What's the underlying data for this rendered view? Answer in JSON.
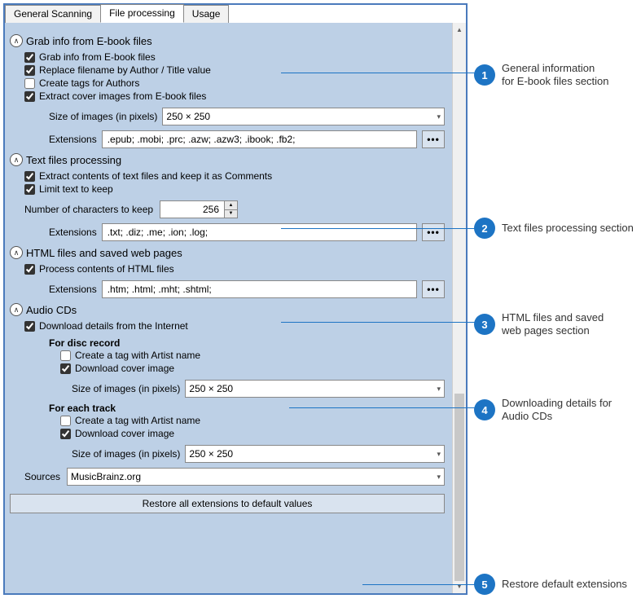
{
  "tabs": {
    "general": "General Scanning",
    "file": "File processing",
    "usage": "Usage"
  },
  "ebook": {
    "title": "Grab info from E-book files",
    "grab": "Grab info from E-book files",
    "replace": "Replace filename by Author / Title value",
    "tags": "Create tags for Authors",
    "extract": "Extract cover images from E-book files",
    "size_label": "Size of images (in pixels)",
    "size_value": "250 × 250",
    "ext_label": "Extensions",
    "ext_value": ".epub; .mobi; .prc; .azw; .azw3; .ibook; .fb2;",
    "more": "•••"
  },
  "text": {
    "title": "Text files processing",
    "extract": "Extract contents of text files and keep it as Comments",
    "limit": "Limit text to keep",
    "num_label": "Number of characters to keep",
    "num_value": "256",
    "ext_label": "Extensions",
    "ext_value": ".txt; .diz; .me; .ion; .log;",
    "more": "•••"
  },
  "html": {
    "title": "HTML files and saved web pages",
    "process": "Process contents of HTML files",
    "ext_label": "Extensions",
    "ext_value": ".htm; .html; .mht; .shtml;",
    "more": "•••"
  },
  "audio": {
    "title": "Audio CDs",
    "download": "Download details from the Internet",
    "disc_header": "For disc record",
    "disc_tag": "Create a tag with Artist name",
    "disc_cover": "Download cover image",
    "disc_size_label": "Size of images (in pixels)",
    "disc_size_value": "250 × 250",
    "track_header": "For each track",
    "track_tag": "Create a tag with Artist name",
    "track_cover": "Download cover image",
    "track_size_label": "Size of images (in pixels)",
    "track_size_value": "250 × 250",
    "sources_label": "Sources",
    "sources_value": "MusicBrainz.org"
  },
  "restore": "Restore all extensions to default values",
  "callouts": {
    "c1": "General information\nfor E-book files section",
    "c2": "Text files processing section",
    "c3": "HTML files and saved\nweb pages section",
    "c4": "Downloading details for Audio CDs",
    "c5": "Restore default extensions"
  }
}
